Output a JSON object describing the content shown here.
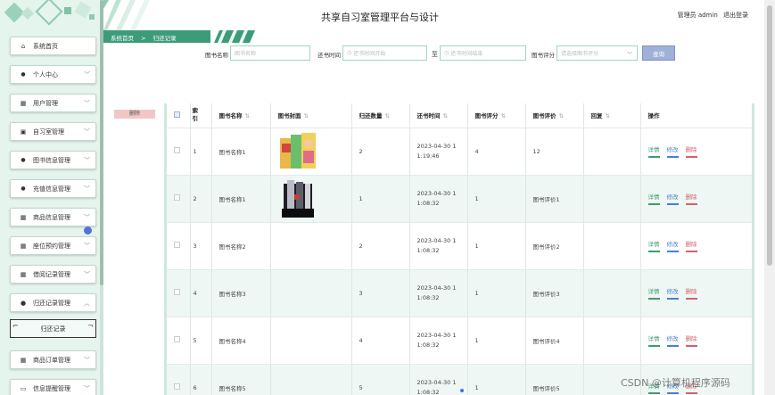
{
  "header": {
    "title": "共享自习室管理平台与设计",
    "user_label": "管理员 admin",
    "logout_label": "退出登录"
  },
  "breadcrumb": {
    "home": "系统首页",
    "separator": ">",
    "current": "归还记录"
  },
  "sidebar": {
    "items": [
      {
        "label": "系统首页",
        "icon": "home-icon",
        "has_chevron": false
      },
      {
        "label": "个人中心",
        "icon": "user-icon",
        "has_chevron": true
      },
      {
        "label": "用户管理",
        "icon": "grid-icon",
        "has_chevron": true
      },
      {
        "label": "自习室管理",
        "icon": "image-icon",
        "has_chevron": true
      },
      {
        "label": "图书信息管理",
        "icon": "user-icon",
        "has_chevron": true
      },
      {
        "label": "充值信息管理",
        "icon": "user-icon",
        "has_chevron": true
      },
      {
        "label": "商品信息管理",
        "icon": "grid-icon",
        "has_chevron": true
      },
      {
        "label": "座位预约管理",
        "icon": "grid-icon",
        "has_chevron": true
      },
      {
        "label": "借阅记录管理",
        "icon": "grid-icon",
        "has_chevron": true
      },
      {
        "label": "归还记录管理",
        "icon": "location-icon",
        "has_chevron": true,
        "expanded": true
      },
      {
        "label": "商品订单管理",
        "icon": "grid-icon",
        "has_chevron": true
      },
      {
        "label": "信息提醒管理",
        "icon": "monitor-icon",
        "has_chevron": true
      }
    ],
    "submenu_label": "归还记录"
  },
  "search": {
    "book_name_label": "图书名称",
    "book_name_placeholder": "图书名称",
    "return_time_label": "还书时间",
    "return_time_start_placeholder": "还书时间开始",
    "range_separator": "至",
    "return_time_end_placeholder": "还书时间结束",
    "rating_label": "图书评分",
    "rating_placeholder": "请选择图书评分",
    "search_button": "查询"
  },
  "toolbar": {
    "delete_button": "删除"
  },
  "table": {
    "headers": [
      "索引",
      "图书名称",
      "图书封面",
      "归还数量",
      "还书时间",
      "图书评分",
      "图书评价",
      "回复",
      "操作"
    ],
    "index_header_line1": "索",
    "index_header_line2": "引",
    "rows": [
      {
        "index": "1",
        "name": "图书名称1",
        "cover": "cover-1",
        "qty": "2",
        "time_line1": "2023-04-30 1",
        "time_line2": "1:19:46",
        "rating": "4",
        "review": "12",
        "reply": ""
      },
      {
        "index": "2",
        "name": "图书名称1",
        "cover": "cover-2",
        "qty": "1",
        "time_line1": "2023-04-30 1",
        "time_line2": "1:08:32",
        "rating": "1",
        "review": "图书评价1",
        "reply": ""
      },
      {
        "index": "3",
        "name": "图书名称2",
        "cover": "",
        "qty": "2",
        "time_line1": "2023-04-30 1",
        "time_line2": "1:08:32",
        "rating": "1",
        "review": "图书评价2",
        "reply": ""
      },
      {
        "index": "4",
        "name": "图书名称3",
        "cover": "",
        "qty": "3",
        "time_line1": "2023-04-30 1",
        "time_line2": "1:08:32",
        "rating": "1",
        "review": "图书评价3",
        "reply": ""
      },
      {
        "index": "5",
        "name": "图书名称4",
        "cover": "",
        "qty": "4",
        "time_line1": "2023-04-30 1",
        "time_line2": "1:08:32",
        "rating": "1",
        "review": "图书评价4",
        "reply": ""
      },
      {
        "index": "6",
        "name": "图书名称5",
        "cover": "",
        "qty": "5",
        "time_line1": "2023-04-30 1",
        "time_line2": "1:08:32",
        "rating": "1",
        "review": "图书评价5",
        "reply": ""
      }
    ],
    "actions": {
      "view": "详情",
      "edit": "修改",
      "delete": "删除"
    }
  },
  "watermark": "CSDN @计算机程序源码",
  "colors": {
    "accent": "#3d9b7a",
    "sidebar_bg": "#e6f4ee",
    "alt_row": "#eef7f3",
    "view": "#3f9b75",
    "edit": "#4a7fd0",
    "delete": "#d2626d"
  }
}
